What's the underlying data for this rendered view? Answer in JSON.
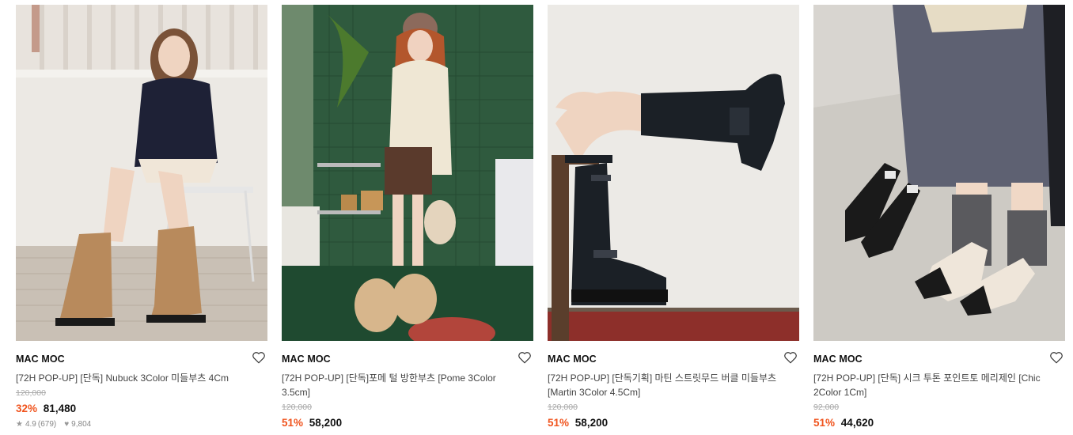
{
  "products": [
    {
      "brand": "MAC MOC",
      "name": "[72H POP-UP] [단독] Nubuck 3Color 미들부츠 4Cm",
      "original_price": "120,000",
      "discount": "32%",
      "price": "81,480",
      "rating": "4.9",
      "review_count": "(679)",
      "likes": "9,804"
    },
    {
      "brand": "MAC MOC",
      "name": "[72H POP-UP] [단독]포메 털 방한부츠 [Pome 3Color 3.5cm]",
      "original_price": "120,000",
      "discount": "51%",
      "price": "58,200"
    },
    {
      "brand": "MAC MOC",
      "name": "[72H POP-UP] [단독기획] 마틴 스트릿무드 버클 미들부츠 [Martin 3Color 4.5Cm]",
      "original_price": "120,000",
      "discount": "51%",
      "price": "58,200"
    },
    {
      "brand": "MAC MOC",
      "name": "[72H POP-UP] [단독] 시크 투톤 포인트토 메리제인 [Chic 2Color 1Cm]",
      "original_price": "92,000",
      "discount": "51%",
      "price": "44,620"
    }
  ],
  "icons": {
    "like": "heart-outline-icon",
    "rating": "star-icon",
    "likes": "heart-filled-icon"
  },
  "colors": {
    "discount": "#f0541e",
    "original_price": "#aaaaaa",
    "brand": "#111111"
  }
}
